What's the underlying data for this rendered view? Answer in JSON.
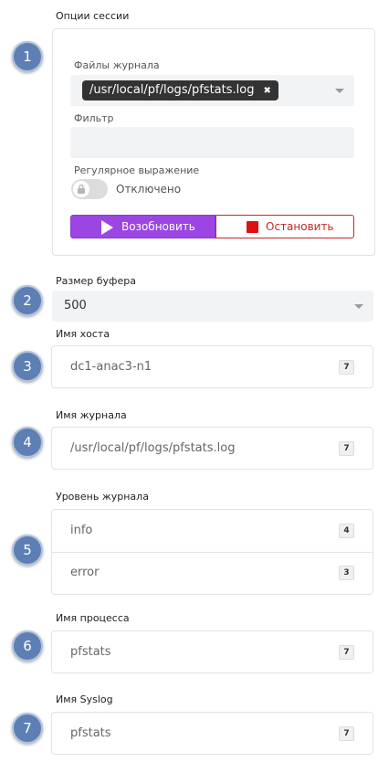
{
  "session": {
    "title": "Опции сессии",
    "step": "1",
    "log_files_label": "Файлы журнала",
    "selected_file": "/usr/local/pf/logs/pfstats.log",
    "chip_remove": "✖",
    "filter_label": "Фильтр",
    "filter_value": "",
    "regex_label": "Регулярное выражение",
    "regex_state": "Отключено",
    "regex_enabled": false,
    "resume_label": "Возобновить",
    "stop_label": "Остановить",
    "accent": "#9b46e2",
    "stop_color": "#c62828"
  },
  "buffer": {
    "step": "2",
    "label": "Размер буфера",
    "value": "500"
  },
  "facets": [
    {
      "step": "3",
      "label": "Имя хоста",
      "items": [
        {
          "value": "dc1-anac3-n1",
          "count": "7"
        }
      ]
    },
    {
      "step": "4",
      "label": "Имя журнала",
      "items": [
        {
          "value": "/usr/local/pf/logs/pfstats.log",
          "count": "7"
        }
      ]
    },
    {
      "step": "5",
      "label": "Уровень журнала",
      "items": [
        {
          "value": "info",
          "count": "4"
        },
        {
          "value": "error",
          "count": "3"
        }
      ]
    },
    {
      "step": "6",
      "label": "Имя процесса",
      "items": [
        {
          "value": "pfstats",
          "count": "7"
        }
      ]
    },
    {
      "step": "7",
      "label": "Имя Syslog",
      "items": [
        {
          "value": "pfstats",
          "count": "7"
        }
      ]
    }
  ],
  "icons": {
    "play": "play-icon",
    "stop": "stop-icon",
    "lock": "lock-icon",
    "dropdown": "chevron-down-icon"
  }
}
